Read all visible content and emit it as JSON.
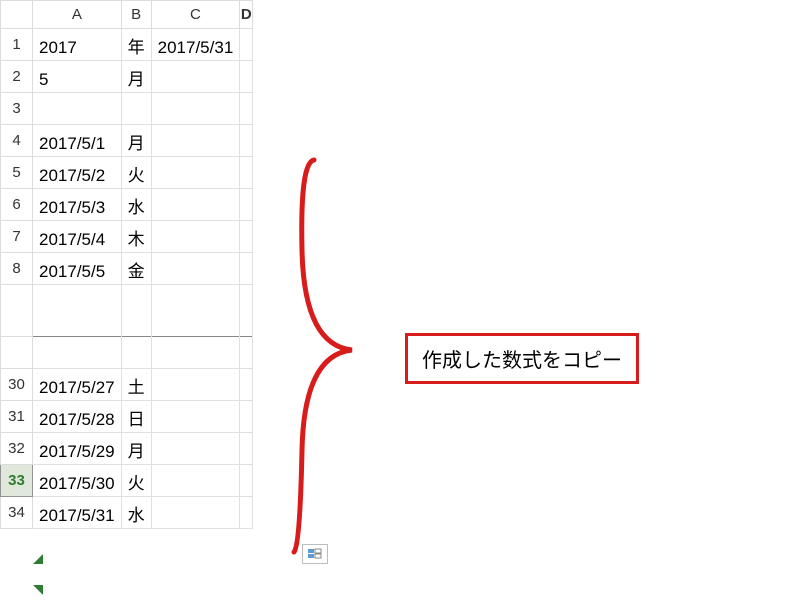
{
  "columns": {
    "a": "A",
    "b": "B",
    "c": "C",
    "d": "D"
  },
  "cells": {
    "r1": {
      "header": "1",
      "a": "2017",
      "b": "年",
      "c": "2017/5/31"
    },
    "r2": {
      "header": "2",
      "a": "5",
      "b": "月",
      "c": ""
    },
    "r3": {
      "header": "3",
      "a": "",
      "b": "",
      "c": ""
    },
    "r4": {
      "header": "4",
      "a": "2017/5/1",
      "b": "月",
      "c": ""
    },
    "r5": {
      "header": "5",
      "a": "2017/5/2",
      "b": "火",
      "c": ""
    },
    "r6": {
      "header": "6",
      "a": "2017/5/3",
      "b": "水",
      "c": ""
    },
    "r7": {
      "header": "7",
      "a": "2017/5/4",
      "b": "木",
      "c": ""
    },
    "r8": {
      "header": "8",
      "a": "2017/5/5",
      "b": "金",
      "c": ""
    },
    "r30": {
      "header": "30",
      "a": "2017/5/27",
      "b": "土",
      "c": ""
    },
    "r31": {
      "header": "31",
      "a": "2017/5/28",
      "b": "日",
      "c": ""
    },
    "r32": {
      "header": "32",
      "a": "2017/5/29",
      "b": "月",
      "c": ""
    },
    "r33": {
      "header": "33",
      "a": "2017/5/30",
      "b": "火",
      "c": ""
    },
    "r34": {
      "header": "34",
      "a": "2017/5/31",
      "b": "水",
      "c": ""
    }
  },
  "annotation": "作成した数式をコピー"
}
